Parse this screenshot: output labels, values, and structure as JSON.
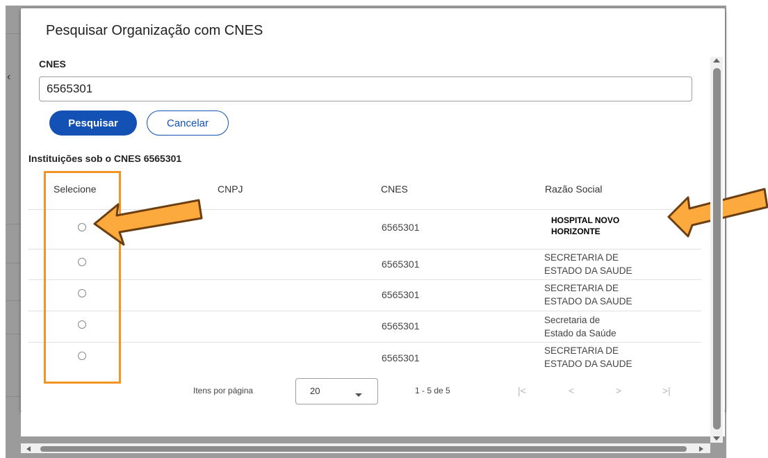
{
  "dialog": {
    "title": "Pesquisar Organização com CNES",
    "cnes_label": "CNES",
    "cnes_value": "6565301",
    "search_button": "Pesquisar",
    "cancel_button": "Cancelar",
    "results_title": "Instituições sob o CNES 6565301"
  },
  "table": {
    "headers": [
      "Selecione",
      "CNPJ",
      "CNES",
      "Razão Social"
    ],
    "rows": [
      {
        "cnpj": "",
        "cnes": "6565301",
        "razao_line1": "HOSPITAL NOVO",
        "razao_line2": "HORIZONTE"
      },
      {
        "cnpj": "",
        "cnes": "6565301",
        "razao_line1": "SECRETARIA DE",
        "razao_line2": "ESTADO DA SAUDE"
      },
      {
        "cnpj": "",
        "cnes": "6565301",
        "razao_line1": "SECRETARIA DE",
        "razao_line2": "ESTADO DA SAUDE"
      },
      {
        "cnpj": "",
        "cnes": "6565301",
        "razao_line1": "Secretaria de",
        "razao_line2": "Estado da Saúde"
      },
      {
        "cnpj": "",
        "cnes": "6565301",
        "razao_line1": "SECRETARIA DE",
        "razao_line2": "ESTADO DA SAUDE"
      }
    ]
  },
  "paginator": {
    "items_label": "Itens por página",
    "page_size": "20",
    "range": "1 - 5 de 5",
    "first": "|<",
    "prev": "<",
    "next": ">",
    "last": ">|"
  },
  "colors": {
    "primary": "#1351b4",
    "annotation": "#f29423",
    "arrow_fill": "#fca93e",
    "arrow_stroke": "#6b3f12"
  },
  "back_glyph": "‹"
}
